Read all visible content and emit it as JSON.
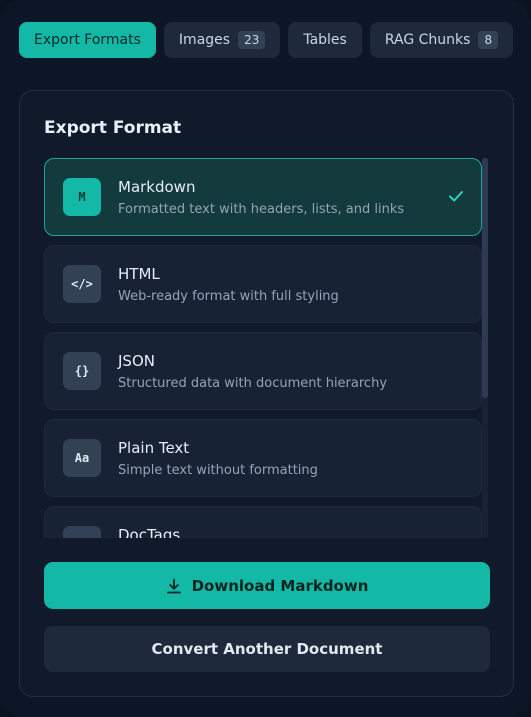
{
  "tabs": [
    {
      "label": "Export Formats",
      "active": true
    },
    {
      "label": "Images",
      "count": "23"
    },
    {
      "label": "Tables"
    },
    {
      "label": "RAG Chunks",
      "count": "8"
    }
  ],
  "panel": {
    "title": "Export Format",
    "options": [
      {
        "icon": "M",
        "icon_name": "markdown-icon",
        "name": "Markdown",
        "desc": "Formatted text with headers, lists, and links",
        "selected": true
      },
      {
        "icon": "</>",
        "icon_name": "code-icon",
        "name": "HTML",
        "desc": "Web-ready format with full styling"
      },
      {
        "icon": "{}",
        "icon_name": "json-braces-icon",
        "name": "JSON",
        "desc": "Structured data with document hierarchy"
      },
      {
        "icon": "Aa",
        "icon_name": "text-icon",
        "name": "Plain Text",
        "desc": "Simple text without formatting"
      },
      {
        "icon": "",
        "icon_name": "doctags-icon",
        "name": "DocTags",
        "desc": ""
      }
    ]
  },
  "actions": {
    "download_label": "Download Markdown",
    "convert_label": "Convert Another Document"
  },
  "colors": {
    "accent": "#14b8a6",
    "background": "#0d1626",
    "panel": "#111a2b"
  }
}
